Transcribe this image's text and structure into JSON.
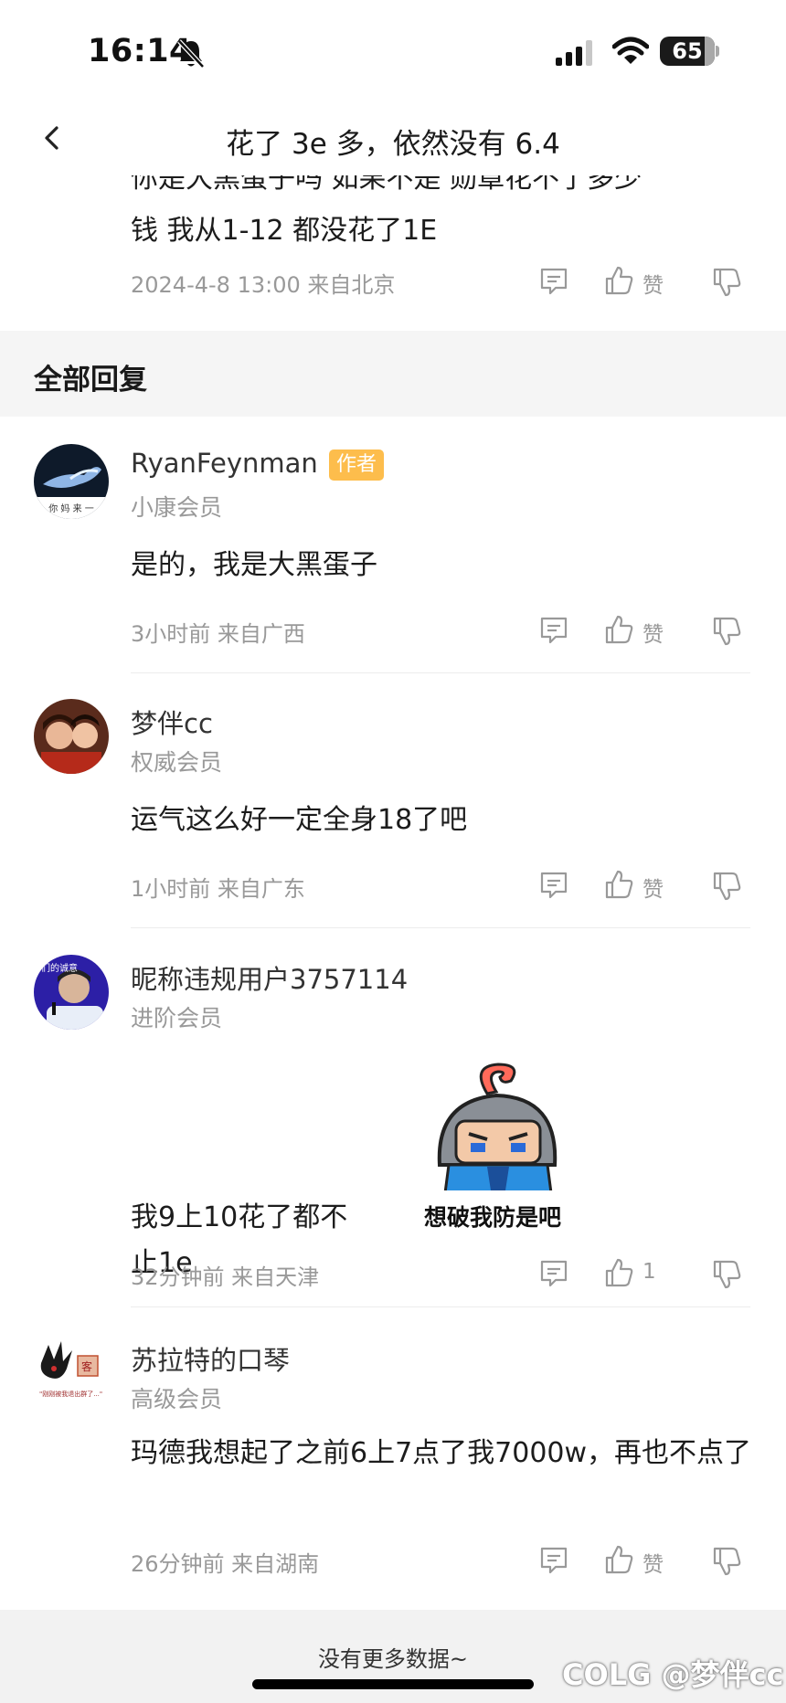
{
  "status_bar": {
    "time": "16:14",
    "battery": "65"
  },
  "nav": {
    "title": "花了 3e 多，依然没有 6.4"
  },
  "parent_comment": {
    "text_line1": "你是大黑蛋子吗 如果不是 勋章花不了多少",
    "text_line2": "钱  我从1-12 都没花了1E",
    "meta": "2024-4-8 13:00  来自北京",
    "like_label": "赞"
  },
  "section": {
    "title": "全部回复"
  },
  "replies": [
    {
      "username": "RyanFeynman",
      "badge": "作者",
      "level": "小康会员",
      "text": "是的，我是大黑蛋子",
      "meta": "3小时前 来自广西",
      "like_label": "赞"
    },
    {
      "username": "梦伴cc",
      "level": "权威会员",
      "text": "运气这么好一定全身18了吧",
      "meta": "1小时前 来自广东",
      "like_label": "赞"
    },
    {
      "username": "昵称违规用户3757114",
      "level": "进阶会员",
      "text": "我9上10花了都不止1e",
      "sticker_caption": "想破我防是吧",
      "meta": "32分钟前 来自天津",
      "like_label": "1"
    },
    {
      "username": "苏拉特的口琴",
      "level": "高级会员",
      "text": "玛德我想起了之前6上7点了我7000w，再也不点了",
      "meta": "26分钟前 来自湖南",
      "like_label": "赞"
    }
  ],
  "footer": {
    "text": "没有更多数据~"
  },
  "watermark": "COLG @梦伴cc"
}
